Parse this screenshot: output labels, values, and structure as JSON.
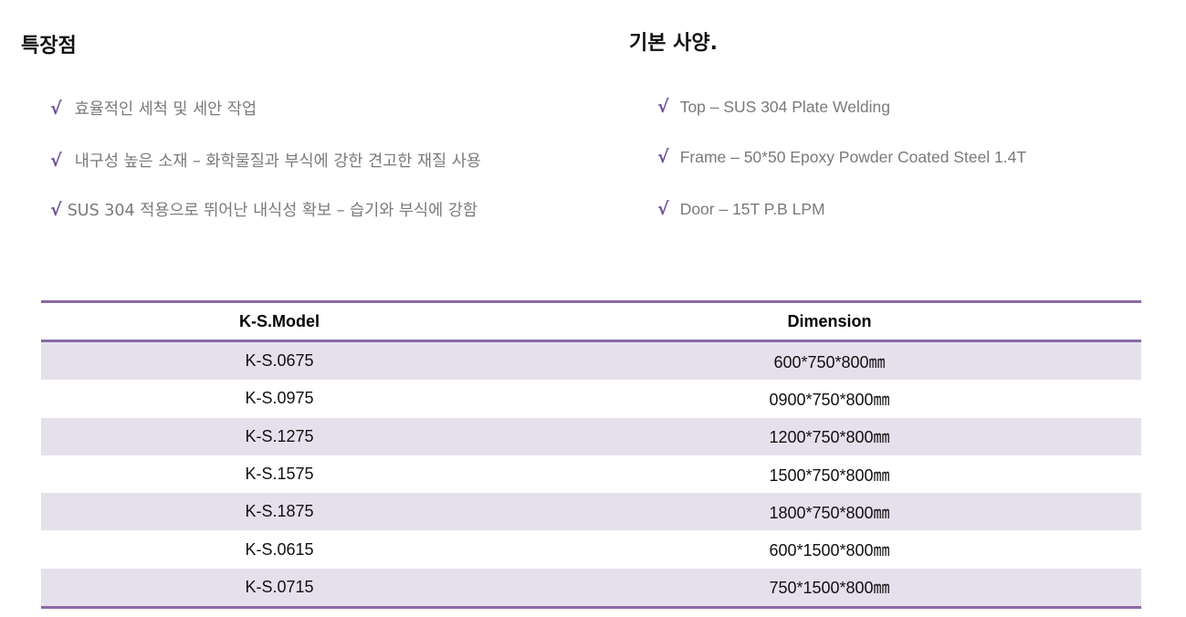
{
  "features": {
    "title": "특장점",
    "items": [
      "효율적인 세척 및 세안 작업",
      "내구성 높은 소재 – 화학물질과 부식에 강한 견고한 재질 사용",
      "SUS 304 적용으로 뛰어난 내식성 확보 – 습기와 부식에 강함"
    ]
  },
  "specs": {
    "title": "기본 사양.",
    "items": [
      "Top – SUS 304 Plate Welding",
      "Frame – 50*50 Epoxy Powder Coated Steel 1.4T",
      "Door – 15T P.B LPM"
    ]
  },
  "bullet_glyph": "√",
  "table": {
    "headers": [
      "K-S.Model",
      "Dimension"
    ],
    "rows": [
      [
        "K-S.0675",
        "600*750*800㎜"
      ],
      [
        "K-S.0975",
        "0900*750*800㎜"
      ],
      [
        "K-S.1275",
        "1200*750*800㎜"
      ],
      [
        "K-S.1575",
        "1500*750*800㎜"
      ],
      [
        "K-S.1875",
        "1800*750*800㎜"
      ],
      [
        "K-S.0615",
        "600*1500*800㎜"
      ],
      [
        "K-S.0715",
        "750*1500*800㎜"
      ]
    ]
  },
  "colors": {
    "accent": "#8a6aa6",
    "check": "#6b4f99",
    "row_stripe": "#e6e0ec",
    "bullet_text": "#7a7a7a"
  }
}
